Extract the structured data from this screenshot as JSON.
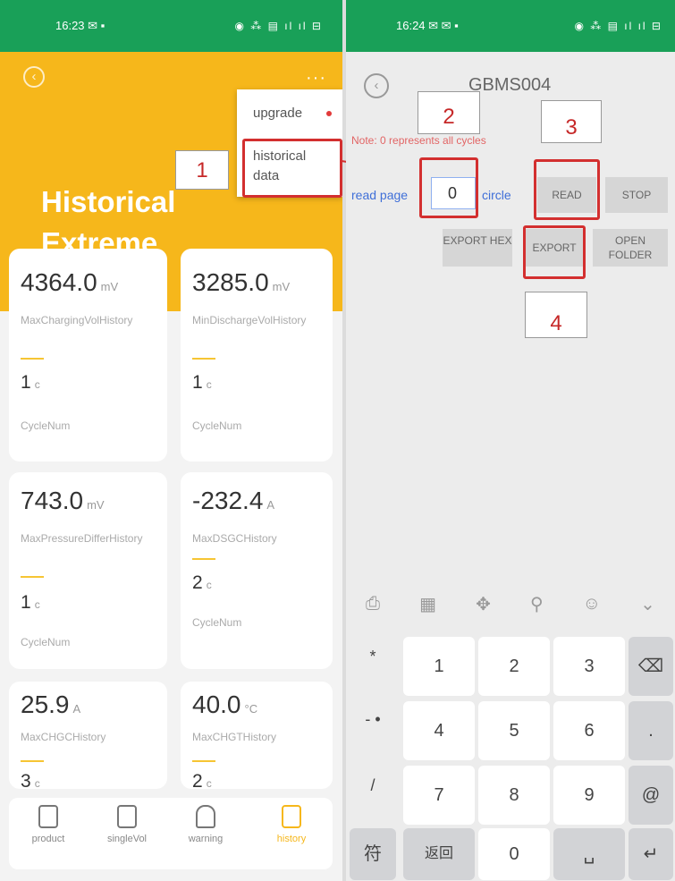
{
  "left": {
    "status_time": "16:23",
    "status_left_icons": "✉ ▪",
    "status_right_icons": "◉ ⁂ ▤ ıl ıl ⊟",
    "title": "Historical Extreme Value",
    "menu": {
      "upgrade": "upgrade",
      "historical_data": "historical data"
    },
    "annotation": "1",
    "cards": [
      {
        "value": "4364.0",
        "unit": "mV",
        "label": "MaxChargingVolHistory",
        "count": "1",
        "count_unit": "c",
        "count_label": "CycleNum"
      },
      {
        "value": "3285.0",
        "unit": "mV",
        "label": "MinDischargeVolHistory",
        "count": "1",
        "count_unit": "c",
        "count_label": "CycleNum"
      },
      {
        "value": "743.0",
        "unit": "mV",
        "label": "MaxPressureDifferHistory",
        "count": "1",
        "count_unit": "c",
        "count_label": "CycleNum"
      },
      {
        "value": "-232.4",
        "unit": "A",
        "label": "MaxDSGCHistory",
        "count": "2",
        "count_unit": "c",
        "count_label": "CycleNum"
      },
      {
        "value": "25.9",
        "unit": "A",
        "label": "MaxCHGCHistory",
        "count": "3",
        "count_unit": "c"
      },
      {
        "value": "40.0",
        "unit": "°C",
        "label": "MaxCHGTHistory",
        "count": "2",
        "count_unit": "c"
      }
    ],
    "tabs": [
      {
        "label": "product",
        "icon": "battery-icon"
      },
      {
        "label": "singleVol",
        "icon": "cell-icon"
      },
      {
        "label": "warning",
        "icon": "bell-icon"
      },
      {
        "label": "history",
        "icon": "history-icon"
      }
    ],
    "colors": {
      "brand": "#f6b71b",
      "status": "#19a058",
      "annotation": "#d32f2f"
    }
  },
  "right": {
    "status_time": "16:24",
    "status_left_icons": "✉ ✉ ▪",
    "status_right_icons": "◉ ⁂ ▤ ıl ıl ⊟",
    "device": "GBMS004",
    "note": "Note: 0 represents all cycles",
    "read_page": "read page",
    "page_value": "0",
    "circle": "circle",
    "buttons": {
      "read": "READ",
      "stop": "STOP",
      "export_hex": "EXPORT HEX",
      "export": "EXPORT",
      "open_folder": "OPEN FOLDER"
    },
    "annotations": [
      "2",
      "3",
      "4"
    ],
    "keyboard": {
      "keys": [
        "1",
        "2",
        "3",
        "4",
        "5",
        "6",
        "7",
        "8",
        "9",
        "0"
      ],
      "side": [
        "*",
        "-\n•",
        "/",
        "符"
      ],
      "back": "返回",
      "at": "@",
      "dot": "."
    }
  }
}
